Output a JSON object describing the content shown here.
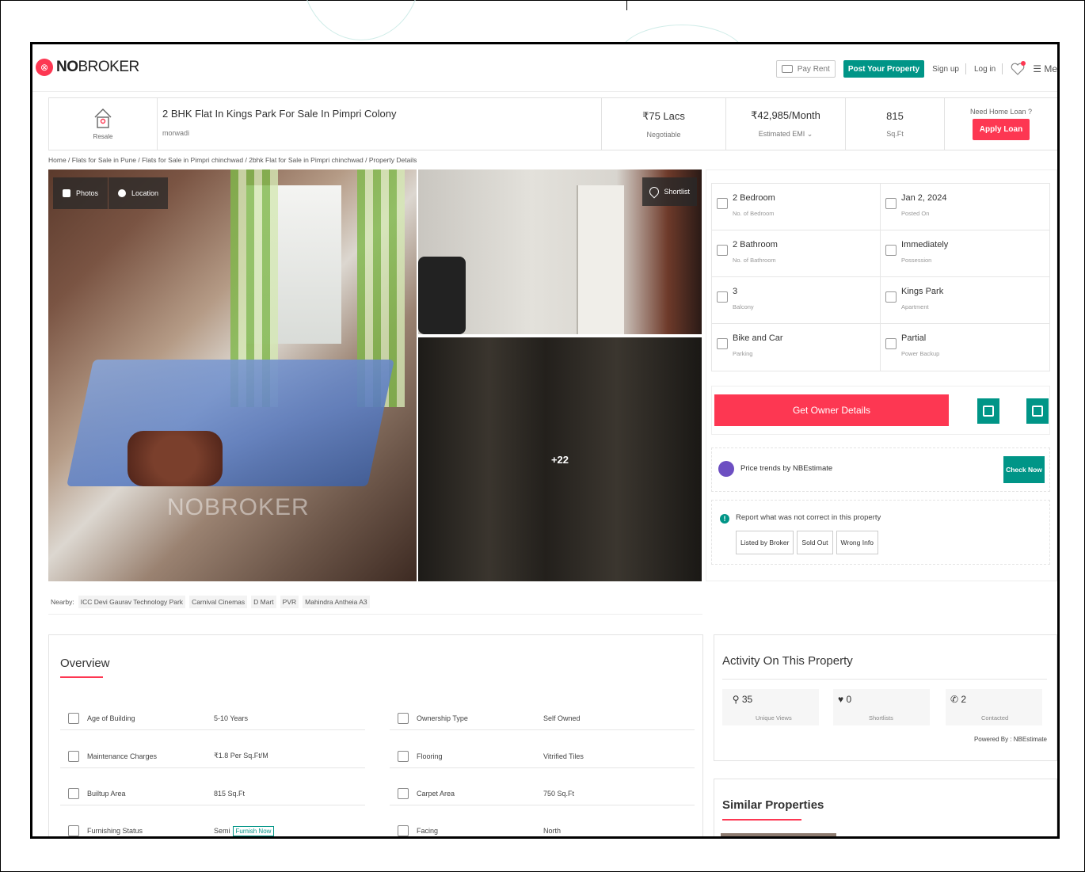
{
  "header": {
    "logo_bold": "NO",
    "logo_rest": "BROKER",
    "pay_rent": "Pay Rent",
    "post_property": "Post Your Property",
    "sign_up": "Sign up",
    "log_in": "Log in",
    "menu": "☰ Me"
  },
  "listing": {
    "type_label": "Resale",
    "title": "2 BHK Flat In Kings Park For Sale In Pimpri Colony",
    "locality": "morwadi",
    "price": "₹75 Lacs",
    "price_note": "Negotiable",
    "emi": "₹42,985/Month",
    "emi_note": "Estimated EMI ⌄",
    "area": "815",
    "area_unit": "Sq.Ft",
    "loan_question": "Need Home Loan ?",
    "apply_loan": "Apply Loan"
  },
  "breadcrumb": "Home / Flats for Sale in Pune / Flats for Sale in Pimpri chinchwad / 2bhk Flat for Sale in Pimpri chinchwad / Property Details",
  "gallery": {
    "photos": "Photos",
    "location": "Location",
    "shortlist": "Shortlist",
    "watermark": "NOBROKER",
    "more_count": "+22"
  },
  "nearby": {
    "label": "Nearby:",
    "places": [
      "ICC Devi Gaurav Technology Park",
      "Carnival Cinemas",
      "D Mart",
      "PVR",
      "Mahindra Antheia A3"
    ]
  },
  "specs": [
    {
      "value": "2 Bedroom",
      "label": "No. of Bedroom"
    },
    {
      "value": "Jan 2, 2024",
      "label": "Posted On"
    },
    {
      "value": "2 Bathroom",
      "label": "No. of Bathroom"
    },
    {
      "value": "Immediately",
      "label": "Possession"
    },
    {
      "value": "3",
      "label": "Balcony"
    },
    {
      "value": "Kings Park",
      "label": "Apartment"
    },
    {
      "value": "Bike and Car",
      "label": "Parking"
    },
    {
      "value": "Partial",
      "label": "Power Backup"
    }
  ],
  "cta": {
    "owner_details": "Get Owner Details",
    "trend_text": "Price trends by NBEstimate",
    "check_now": "Check Now",
    "report_text": "Report what was not correct in this property",
    "report_buttons": [
      "Listed by Broker",
      "Sold Out",
      "Wrong Info"
    ]
  },
  "overview": {
    "title": "Overview",
    "rows": [
      {
        "key": "Age of Building",
        "value": "5-10 Years"
      },
      {
        "key": "Ownership Type",
        "value": "Self Owned"
      },
      {
        "key": "Maintenance Charges",
        "value": "₹1.8 Per Sq.Ft/M"
      },
      {
        "key": "Flooring",
        "value": "Vitrified Tiles"
      },
      {
        "key": "Builtup Area",
        "value": "815 Sq.Ft"
      },
      {
        "key": "Carpet Area",
        "value": "750 Sq.Ft"
      },
      {
        "key": "Furnishing Status",
        "value": "Semi"
      },
      {
        "key": "Facing",
        "value": "North"
      }
    ],
    "furnish_now": "Furnish Now"
  },
  "activity": {
    "title": "Activity On This Property",
    "stats": [
      {
        "value": "35",
        "label": "Unique Views"
      },
      {
        "value": "0",
        "label": "Shortlists"
      },
      {
        "value": "2",
        "label": "Contacted"
      }
    ],
    "powered_by": "Powered By : NBEstimate"
  },
  "similar": {
    "title": "Similar Properties"
  },
  "colors": {
    "brand_red": "#fd3752",
    "brand_teal": "#009587"
  }
}
